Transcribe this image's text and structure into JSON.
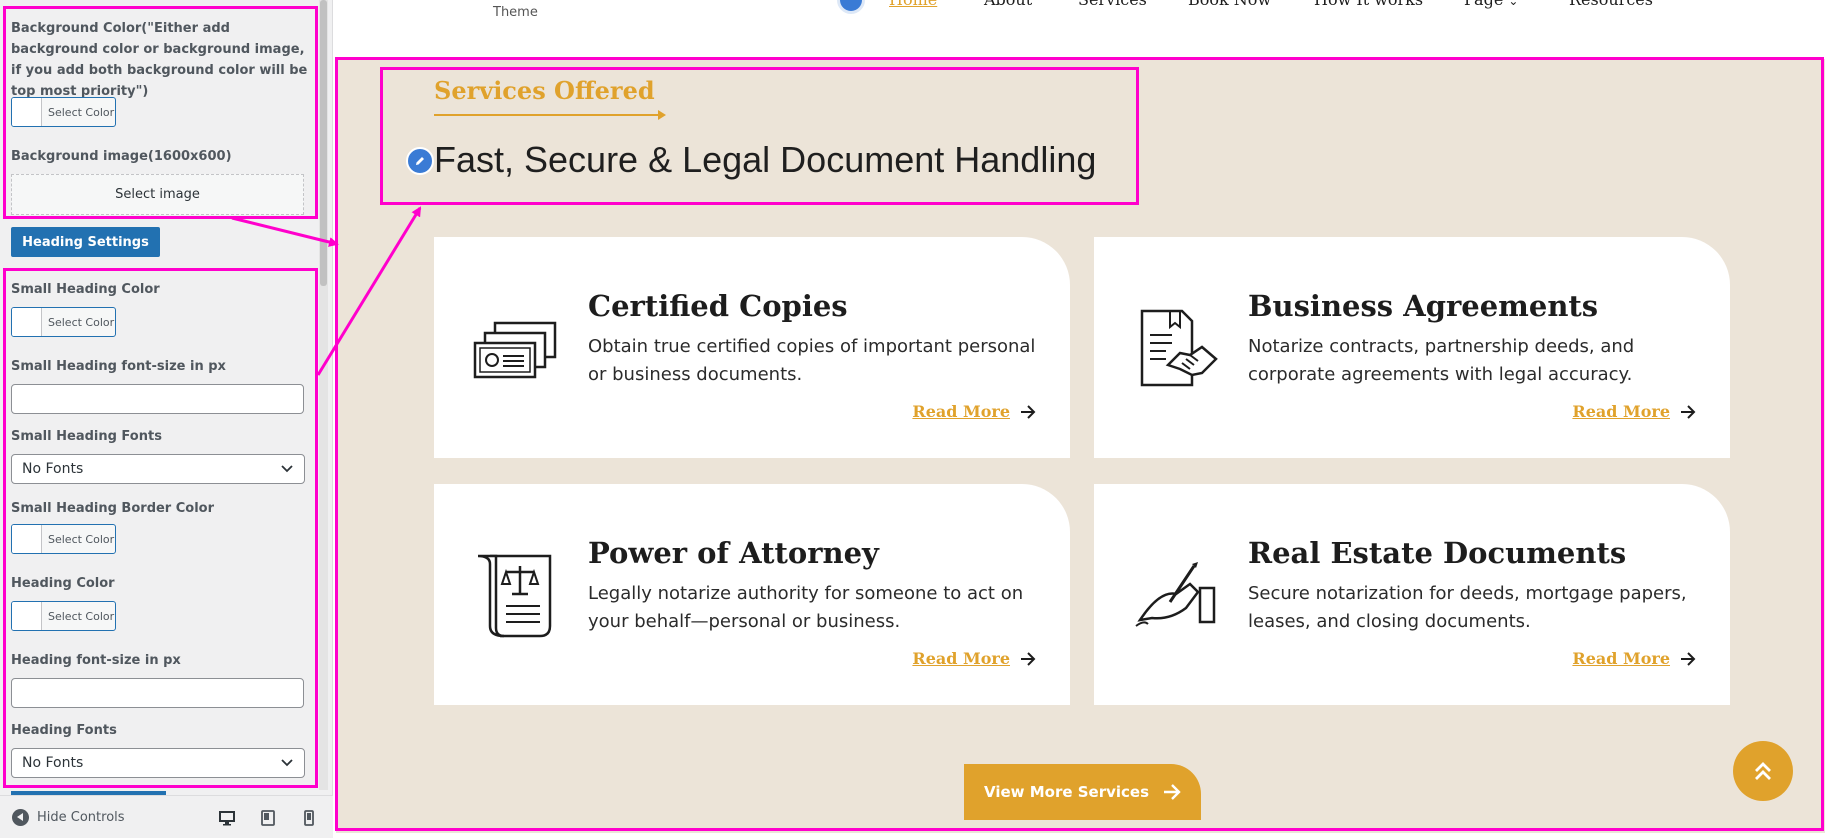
{
  "sidebar": {
    "bg_color_label": "Background Color(\"Either add background color or background image, if you add both background color will be top most priority\")",
    "select_color": "Select Color",
    "bg_image_label": "Background image(1600x600)",
    "select_image": "Select image",
    "heading_settings": "Heading Settings",
    "small_heading_color": "Small Heading Color",
    "small_heading_size": "Small Heading font-size in px",
    "small_heading_fonts": "Small Heading Fonts",
    "no_fonts": "No Fonts",
    "small_heading_border_color": "Small Heading Border Color",
    "heading_color": "Heading Color",
    "heading_size": "Heading font-size in px",
    "heading_fonts": "Heading Fonts",
    "hide_controls": "Hide Controls"
  },
  "site": {
    "brand_sub": "Theme",
    "nav": [
      "Home",
      "About",
      "Services",
      "Book Now",
      "How It works",
      "Page",
      "Resources"
    ],
    "small_heading": "Services Offered",
    "main_heading": "Fast, Secure & Legal Document Handling",
    "read_more": "Read More",
    "view_more": "View More Services",
    "cards": [
      {
        "title": "Certified Copies",
        "desc": "Obtain true certified copies of important personal or business documents.",
        "icon": "certificate-icon"
      },
      {
        "title": "Business Agreements",
        "desc": "Notarize contracts, partnership deeds, and corporate agreements with legal accuracy.",
        "icon": "handshake-document-icon"
      },
      {
        "title": "Power of Attorney",
        "desc": "Legally notarize authority for someone to act on your behalf—personal or business.",
        "icon": "scroll-scales-icon"
      },
      {
        "title": "Real Estate Documents",
        "desc": "Secure notarization for deeds, mortgage papers, leases, and closing documents.",
        "icon": "hand-signing-icon"
      }
    ]
  },
  "colors": {
    "accent": "#e0a22c",
    "section_bg": "#ece4d8",
    "annotation": "#ff00cc",
    "wp_blue": "#2271b1"
  }
}
